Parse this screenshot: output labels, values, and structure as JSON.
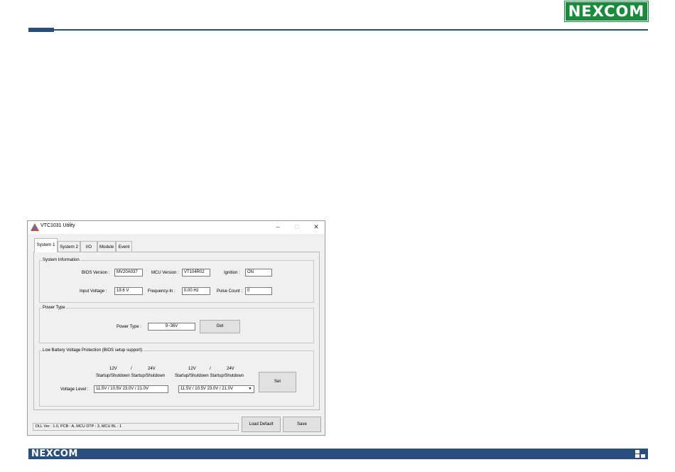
{
  "brand": {
    "logo_text": "NEXCOM",
    "footer_logo_text": "NEXCOM",
    "primary_color": "#2a4f7f",
    "logo_color": "#1a8a3c"
  },
  "window": {
    "title": "VTC1031 Utility",
    "icon": "app-icon",
    "controls": {
      "minimize": "–",
      "maximize": "□",
      "close": "✕"
    }
  },
  "tabs": [
    {
      "label": "System 1",
      "active": true
    },
    {
      "label": "System 2",
      "active": false
    },
    {
      "label": "I/O",
      "active": false
    },
    {
      "label": "Module",
      "active": false
    },
    {
      "label": "Event",
      "active": false
    }
  ],
  "system_info": {
    "title": "System Information",
    "bios_label": "BIOS Version :",
    "bios_value": "MV20A037",
    "mcu_label": "MCU Version :",
    "mcu_value": "VT104R02",
    "ignition_label": "Ignition :",
    "ignition_value": "ON",
    "input_voltage_label": "Input Voltage :",
    "input_voltage_value": "19.6 V",
    "frequency_label": "Frequency-In :",
    "frequency_value": "0.00 Hz",
    "pulse_label": "Pulse Count :",
    "pulse_value": "0"
  },
  "power_type": {
    "title": "Power Type",
    "label": "Power Type :",
    "value": "9~36V",
    "get_button": "Get"
  },
  "low_battery": {
    "title": "Low Battery Voltage Protection (BIOS setup support)",
    "group1_12v": "12V",
    "group1_slash": "/",
    "group1_24v": "24V",
    "group1_header": "Startup/Shutdown Startup/Shutdown",
    "group2_12v": "12V",
    "group2_slash": "/",
    "group2_24v": "24V",
    "group2_header": "Startup/Shutdown Startup/Shutdown",
    "voltage_label": "Voltage Level :",
    "field1_value": "11.5V / 10.5V    23.0V / 21.0V",
    "combo_value": "11.5V / 10.5V    23.0V / 21.0V",
    "set_button": "Set"
  },
  "footer": {
    "status_text": "DLL Ver : 1.0, PCB : A, MCU DTP : 3, MCU BL : 1",
    "load_default_button": "Load Default",
    "save_button": "Save"
  }
}
